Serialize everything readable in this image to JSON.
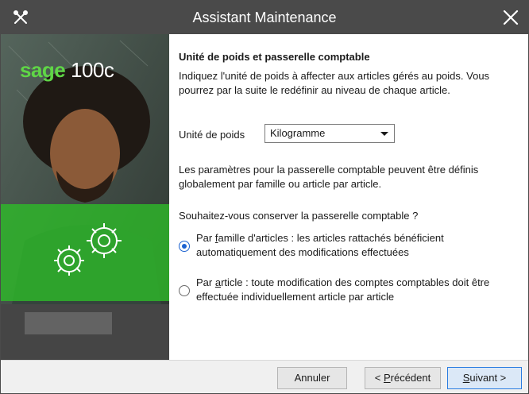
{
  "window": {
    "title": "Assistant Maintenance"
  },
  "brand": {
    "logo_part1": "sage",
    "logo_part2": " 100c"
  },
  "content": {
    "heading": "Unité de poids et passerelle comptable",
    "intro": "Indiquez l'unité de poids à affecter aux articles gérés au poids. Vous pourrez par la suite le redéfinir au niveau de chaque article.",
    "poids_label": "Unité de poids",
    "poids_value": "Kilogramme",
    "description": "Les paramètres pour la passerelle comptable peuvent être définis globalement par famille ou article par article.",
    "question": "Souhaitez-vous conserver la passerelle comptable ?",
    "option1": {
      "prefix": "Par ",
      "mnemonic": "f",
      "rest": "amille d'articles : les articles rattachés bénéficient automatiquement des modifications effectuées",
      "checked": true
    },
    "option2": {
      "prefix": "Par ",
      "mnemonic": "a",
      "rest": "rticle : toute modification des comptes comptables doit être effectuée individuellement article par article",
      "checked": false
    }
  },
  "footer": {
    "cancel_label": "Annuler",
    "prev_prefix": "< ",
    "prev_mnemonic": "P",
    "prev_rest": "récédent",
    "next_mnemonic": "S",
    "next_rest": "uivant >"
  },
  "colors": {
    "titlebar": "#4a4a4a",
    "accent_green": "#5fd646",
    "radio_selected": "#1c62d0",
    "primary_button_border": "#2a7de1"
  },
  "icons": {
    "app": "tools-icon",
    "close": "close-icon",
    "dropdown": "chevron-down-icon",
    "gears": "gears-icon"
  }
}
